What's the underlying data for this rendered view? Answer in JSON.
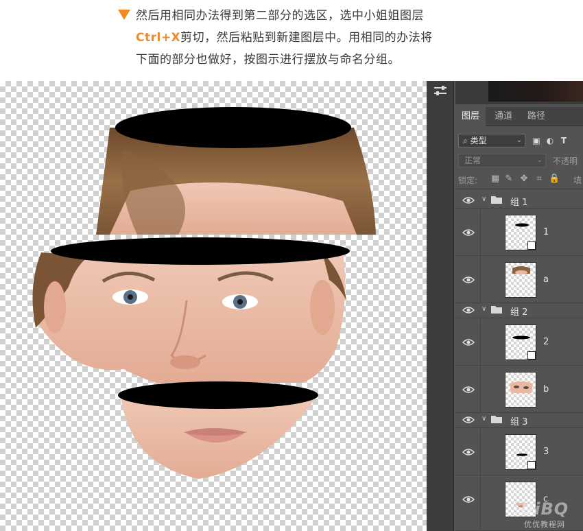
{
  "instruction": {
    "line1": "然后用相同办法得到第二部分的选区，选中小姐姐图层",
    "shortcut": "Ctrl+X",
    "line2_rest": "剪切，然后粘贴到新建图层中。用相同的办法将",
    "line3": "下面的部分也做好，按图示进行摆放与命名分组。",
    "accent_color": "#f08a24"
  },
  "panel": {
    "tabs": [
      {
        "label": "图层",
        "active": true
      },
      {
        "label": "通道",
        "active": false
      },
      {
        "label": "路径",
        "active": false
      }
    ],
    "filter": {
      "icon": "search-icon",
      "label": "类型"
    },
    "filter_icons": [
      "image-filter-icon",
      "adjustment-filter-icon",
      "type-filter-icon"
    ],
    "type_icon_label": "T",
    "blend_mode": "正常",
    "opacity_label": "不透明",
    "lock_label": "锁定:",
    "lock_icons": [
      "lock-transparent-icon",
      "lock-brush-icon",
      "lock-move-icon",
      "lock-artboard-icon",
      "lock-all-icon"
    ],
    "fill_label": "填",
    "groups": [
      {
        "name": "组 1",
        "layers": [
          {
            "name": "1",
            "type": "mask"
          },
          {
            "name": "a",
            "type": "face"
          }
        ]
      },
      {
        "name": "组 2",
        "layers": [
          {
            "name": "2",
            "type": "mask"
          },
          {
            "name": "b",
            "type": "face"
          }
        ]
      },
      {
        "name": "组 3",
        "layers": [
          {
            "name": "3",
            "type": "mask"
          },
          {
            "name": "c",
            "type": "face"
          }
        ]
      }
    ]
  },
  "watermark": {
    "logo_text": "UiBQ",
    "site_name": "优优教程网"
  }
}
